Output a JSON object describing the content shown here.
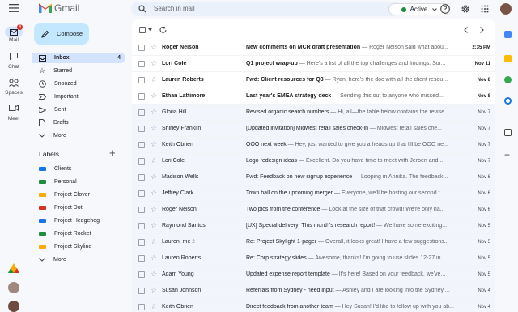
{
  "app": {
    "name": "Gmail"
  },
  "search": {
    "placeholder": "Search in mail"
  },
  "status": {
    "label": "Active"
  },
  "rail": [
    {
      "label": "Mail",
      "badge": "4"
    },
    {
      "label": "Chat"
    },
    {
      "label": "Spaces"
    },
    {
      "label": "Meet"
    }
  ],
  "compose": {
    "label": "Compose"
  },
  "folders": [
    {
      "label": "Inbox",
      "count": "4"
    },
    {
      "label": "Starred"
    },
    {
      "label": "Snoozed"
    },
    {
      "label": "Important"
    },
    {
      "label": "Sent"
    },
    {
      "label": "Drafts"
    },
    {
      "label": "More"
    }
  ],
  "labels_title": "Labels",
  "labels": [
    {
      "name": "Clients",
      "color": "#1a73e8"
    },
    {
      "name": "Personal",
      "color": "#1e8e3e"
    },
    {
      "name": "Project Clover",
      "color": "#f9ab00"
    },
    {
      "name": "Project Dot",
      "color": "#d93025"
    },
    {
      "name": "Project Hedgehog",
      "color": "#1a73e8"
    },
    {
      "name": "Project Rocket",
      "color": "#1e8e3e"
    },
    {
      "name": "Project Skyline",
      "color": "#f9ab00"
    }
  ],
  "labels_more": "More",
  "emails": [
    {
      "sender": "Roger Nelson",
      "subject": "New comments on MCR draft presentation",
      "snippet": " — Roger Nelson said what abou...",
      "date": "2:35 PM",
      "unread": true
    },
    {
      "sender": "Lori Cole",
      "subject": "Q1 project wrap-up",
      "snippet": " — Here's a list of all the top challenges and findings. Sur...",
      "date": "Nov 11",
      "unread": true
    },
    {
      "sender": "Lauren Roberts",
      "subject": "Fwd: Client resources for Q3",
      "snippet": " — Ryan, here's the doc with all the client resou...",
      "date": "Nov 8",
      "unread": true
    },
    {
      "sender": "Ethan Lattimore",
      "subject": "Last year's EMEA strategy deck",
      "snippet": " — Sending this out to anyone who missed...",
      "date": "Nov 8",
      "unread": true
    },
    {
      "sender": "Gloria Hill",
      "subject": "Revised organic search numbers",
      "snippet": " — Hi, all—the table below contains the revise...",
      "date": "Nov 7",
      "unread": false
    },
    {
      "sender": "Shirley Franklin",
      "subject": "[Updated invitation] Midwest retail sales check-in",
      "snippet": " — Midwest retail sales che...",
      "date": "Nov 7",
      "unread": false
    },
    {
      "sender": "Keith Obrien",
      "subject": "OOO next week",
      "snippet": " — Hey, just wanted to give you a heads up that I'll be OOO ne...",
      "date": "Nov 7",
      "unread": false
    },
    {
      "sender": "Lori Cole",
      "subject": "Logo redesign ideas",
      "snippet": " — Excellent. Do you have time to meet with Jeroen and...",
      "date": "Nov 7",
      "unread": false
    },
    {
      "sender": "Madison Wells",
      "subject": "Fwd: Feedback on new signup experience",
      "snippet": " — Looping in Annika. The feedback...",
      "date": "Nov 6",
      "unread": false
    },
    {
      "sender": "Jeffrey Clark",
      "subject": "Town hall on the upcoming merger",
      "snippet": " — Everyone, we'll be hosting our second t...",
      "date": "Nov 6",
      "unread": false
    },
    {
      "sender": "Roger Nelson",
      "subject": "Two pics from the conference",
      "snippet": " — Look at the size of that crowd! We're only ha...",
      "date": "Nov 6",
      "unread": false
    },
    {
      "sender": "Raymond Santos",
      "subject": "[UX] Special delivery! This month's research report!",
      "snippet": " — We have some exciting...",
      "date": "Nov 5",
      "unread": false
    },
    {
      "sender": "Lauren, me",
      "count": "2",
      "subject": "Re: Project Skylight 1-pager",
      "snippet": " — Overall, it looks great! I have a few suggestions...",
      "date": "Nov 5",
      "unread": false
    },
    {
      "sender": "Lauren Roberts",
      "subject": "Re: Corp strategy slides",
      "snippet": " — Awesome, thanks! I'm going to use slides 12-27 in...",
      "date": "Nov 5",
      "unread": false
    },
    {
      "sender": "Adam Young",
      "subject": "Updated expense report template",
      "snippet": " — It's here! Based on your feedback, we've...",
      "date": "Nov 5",
      "unread": false
    },
    {
      "sender": "Susan Johnson",
      "subject": "Referrals from Sydney - need input",
      "snippet": " — Ashley and I are looking into the Sydney ...",
      "date": "Nov 4",
      "unread": false
    },
    {
      "sender": "Keith Obrien",
      "subject": "Direct feedback from another team",
      "snippet": " — Hey Susan! I'd like to follow up with you ab...",
      "date": "Nov 4",
      "unread": false
    }
  ],
  "colors": {
    "accent": "#1a73e8",
    "compose_bg": "#c2e7ff",
    "selected_bg": "#d3e3fd"
  }
}
